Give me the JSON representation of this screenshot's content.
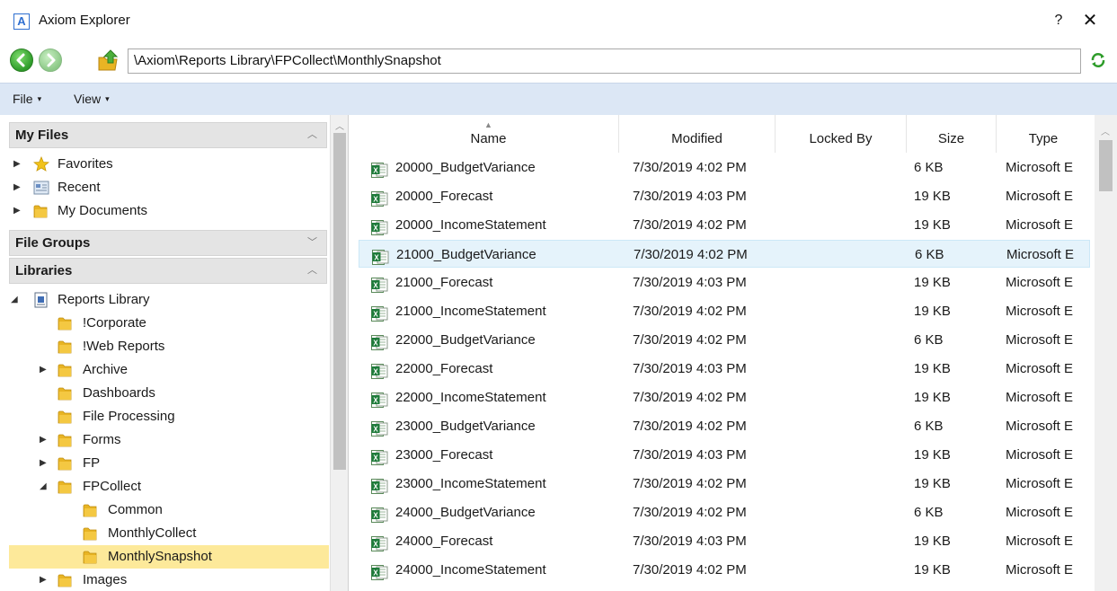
{
  "window": {
    "title": "Axiom Explorer",
    "logo_letter": "A",
    "help_label": "?",
    "close_label": "✕"
  },
  "address": {
    "path": "\\Axiom\\Reports Library\\FPCollect\\MonthlySnapshot"
  },
  "menu": {
    "file": "File",
    "view": "View",
    "caret": "▾"
  },
  "sidebar": {
    "my_files": {
      "title": "My Files",
      "toggle": "︿",
      "items": [
        {
          "label": "Favorites",
          "icon": "star-icon"
        },
        {
          "label": "Recent",
          "icon": "recent-icon"
        },
        {
          "label": "My Documents",
          "icon": "folder-icon"
        }
      ]
    },
    "file_groups": {
      "title": "File Groups",
      "toggle": "﹀"
    },
    "libraries": {
      "title": "Libraries",
      "toggle": "︿",
      "root": "Reports Library",
      "items": [
        {
          "label": "!Corporate"
        },
        {
          "label": "!Web Reports"
        },
        {
          "label": "Archive"
        },
        {
          "label": "Dashboards"
        },
        {
          "label": "File Processing"
        },
        {
          "label": "Forms"
        },
        {
          "label": "FP"
        },
        {
          "label": "FPCollect"
        },
        {
          "label": "Common"
        },
        {
          "label": "MonthlyCollect"
        },
        {
          "label": "MonthlySnapshot"
        },
        {
          "label": "Images"
        }
      ]
    }
  },
  "file_list": {
    "columns": {
      "name": "Name",
      "modified": "Modified",
      "locked_by": "Locked By",
      "size": "Size",
      "type": "Type"
    },
    "sort_indicator": "▲",
    "rows": [
      {
        "name": "20000_BudgetVariance",
        "modified": "7/30/2019 4:02 PM",
        "locked_by": "",
        "size": "6 KB",
        "type": "Microsoft E"
      },
      {
        "name": "20000_Forecast",
        "modified": "7/30/2019 4:03 PM",
        "locked_by": "",
        "size": "19 KB",
        "type": "Microsoft E"
      },
      {
        "name": "20000_IncomeStatement",
        "modified": "7/30/2019 4:02 PM",
        "locked_by": "",
        "size": "19 KB",
        "type": "Microsoft E"
      },
      {
        "name": "21000_BudgetVariance",
        "modified": "7/30/2019 4:02 PM",
        "locked_by": "",
        "size": "6 KB",
        "type": "Microsoft E"
      },
      {
        "name": "21000_Forecast",
        "modified": "7/30/2019 4:03 PM",
        "locked_by": "",
        "size": "19 KB",
        "type": "Microsoft E"
      },
      {
        "name": "21000_IncomeStatement",
        "modified": "7/30/2019 4:02 PM",
        "locked_by": "",
        "size": "19 KB",
        "type": "Microsoft E"
      },
      {
        "name": "22000_BudgetVariance",
        "modified": "7/30/2019 4:02 PM",
        "locked_by": "",
        "size": "6 KB",
        "type": "Microsoft E"
      },
      {
        "name": "22000_Forecast",
        "modified": "7/30/2019 4:03 PM",
        "locked_by": "",
        "size": "19 KB",
        "type": "Microsoft E"
      },
      {
        "name": "22000_IncomeStatement",
        "modified": "7/30/2019 4:02 PM",
        "locked_by": "",
        "size": "19 KB",
        "type": "Microsoft E"
      },
      {
        "name": "23000_BudgetVariance",
        "modified": "7/30/2019 4:02 PM",
        "locked_by": "",
        "size": "6 KB",
        "type": "Microsoft E"
      },
      {
        "name": "23000_Forecast",
        "modified": "7/30/2019 4:03 PM",
        "locked_by": "",
        "size": "19 KB",
        "type": "Microsoft E"
      },
      {
        "name": "23000_IncomeStatement",
        "modified": "7/30/2019 4:02 PM",
        "locked_by": "",
        "size": "19 KB",
        "type": "Microsoft E"
      },
      {
        "name": "24000_BudgetVariance",
        "modified": "7/30/2019 4:02 PM",
        "locked_by": "",
        "size": "6 KB",
        "type": "Microsoft E"
      },
      {
        "name": "24000_Forecast",
        "modified": "7/30/2019 4:03 PM",
        "locked_by": "",
        "size": "19 KB",
        "type": "Microsoft E"
      },
      {
        "name": "24000_IncomeStatement",
        "modified": "7/30/2019 4:02 PM",
        "locked_by": "",
        "size": "19 KB",
        "type": "Microsoft E"
      }
    ]
  },
  "colors": {
    "selected_tree": "#fde99a",
    "selected_row": "#e5f3fb",
    "menubar": "#dce7f5",
    "folder": "#e8b424"
  }
}
